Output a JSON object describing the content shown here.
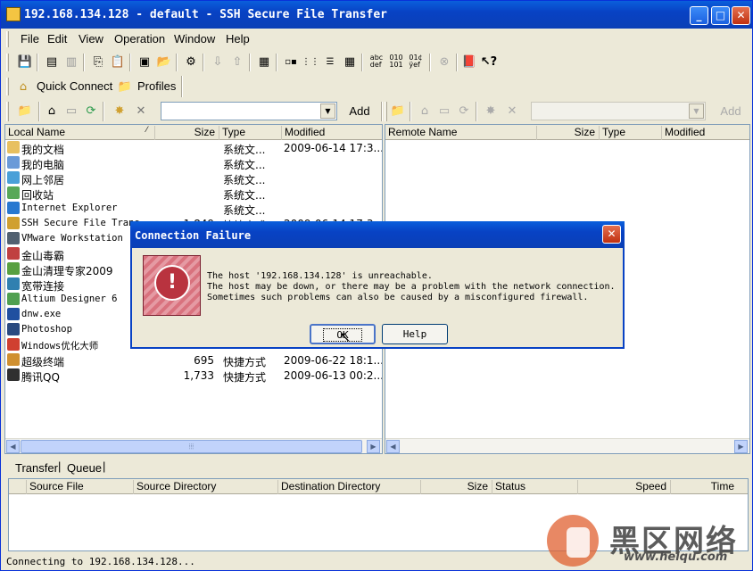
{
  "window": {
    "title": "192.168.134.128 - default - SSH Secure File Transfer"
  },
  "menu": [
    "File",
    "Edit",
    "View",
    "Operation",
    "Window",
    "Help"
  ],
  "quick": {
    "connect": "Quick Connect",
    "profiles": "Profiles"
  },
  "local": {
    "add": "Add",
    "headers": [
      "Local Name",
      "Size",
      "Type",
      "Modified"
    ],
    "rows": [
      {
        "name": "我的文档",
        "size": "",
        "type": "系统文...",
        "modified": "2009-06-14 17:3...",
        "color": "#e8c060"
      },
      {
        "name": "我的电脑",
        "size": "",
        "type": "系统文...",
        "modified": "",
        "color": "#6a9ad8"
      },
      {
        "name": "网上邻居",
        "size": "",
        "type": "系统文...",
        "modified": "",
        "color": "#4aa0d8"
      },
      {
        "name": "回收站",
        "size": "",
        "type": "系统文...",
        "modified": "",
        "color": "#58a858"
      },
      {
        "name": "Internet Explorer",
        "size": "",
        "type": "系统文...",
        "modified": "",
        "color": "#2878d0"
      },
      {
        "name": "SSH Secure File Trans...",
        "size": "1,849",
        "type": "快捷方式",
        "modified": "2009-06-14 17:3...",
        "color": "#d0a030"
      },
      {
        "name": "VMware Workstation",
        "size": "",
        "type": "",
        "modified": "",
        "color": "#506070"
      },
      {
        "name": "金山毒霸",
        "size": "",
        "type": "",
        "modified": "",
        "color": "#c04040"
      },
      {
        "name": "金山清理专家2009",
        "size": "",
        "type": "",
        "modified": "",
        "color": "#58a040"
      },
      {
        "name": "宽带连接",
        "size": "",
        "type": "",
        "modified": "",
        "color": "#3080b0"
      },
      {
        "name": "Altium Designer 6",
        "size": "",
        "type": "",
        "modified": "",
        "color": "#50a050"
      },
      {
        "name": "dnw.exe",
        "size": "",
        "type": "",
        "modified": "",
        "color": "#2050a0"
      },
      {
        "name": "Photoshop",
        "size": "",
        "type": "",
        "modified": "",
        "color": "#2a4a80"
      },
      {
        "name": "Windows优化大师",
        "size": "",
        "type": "",
        "modified": "",
        "color": "#d04030"
      },
      {
        "name": "超级终端",
        "size": "695",
        "type": "快捷方式",
        "modified": "2009-06-22 18:1...",
        "color": "#d09030"
      },
      {
        "name": "腾讯QQ",
        "size": "1,733",
        "type": "快捷方式",
        "modified": "2009-06-13 00:2...",
        "color": "#303030"
      }
    ]
  },
  "remote": {
    "add": "Add",
    "headers": [
      "Remote Name",
      "Size",
      "Type",
      "Modified"
    ]
  },
  "transfer": {
    "tabs": [
      "Transfer",
      "Queue"
    ],
    "headers": [
      "Source File",
      "Source Directory",
      "Destination Directory",
      "Size",
      "Status",
      "Speed",
      "Time"
    ]
  },
  "status": {
    "text": "Connecting to 192.168.134.128..."
  },
  "dialog": {
    "title": "Connection Failure",
    "lines": [
      "The host '192.168.134.128' is unreachable.",
      "The host may be down, or there may be a problem with the network connection.",
      "Sometimes such problems can also be caused by a misconfigured firewall."
    ],
    "ok": "OK",
    "help": "Help"
  },
  "watermark": {
    "brand": "黑区网络",
    "url": "www.heiqu.com"
  }
}
